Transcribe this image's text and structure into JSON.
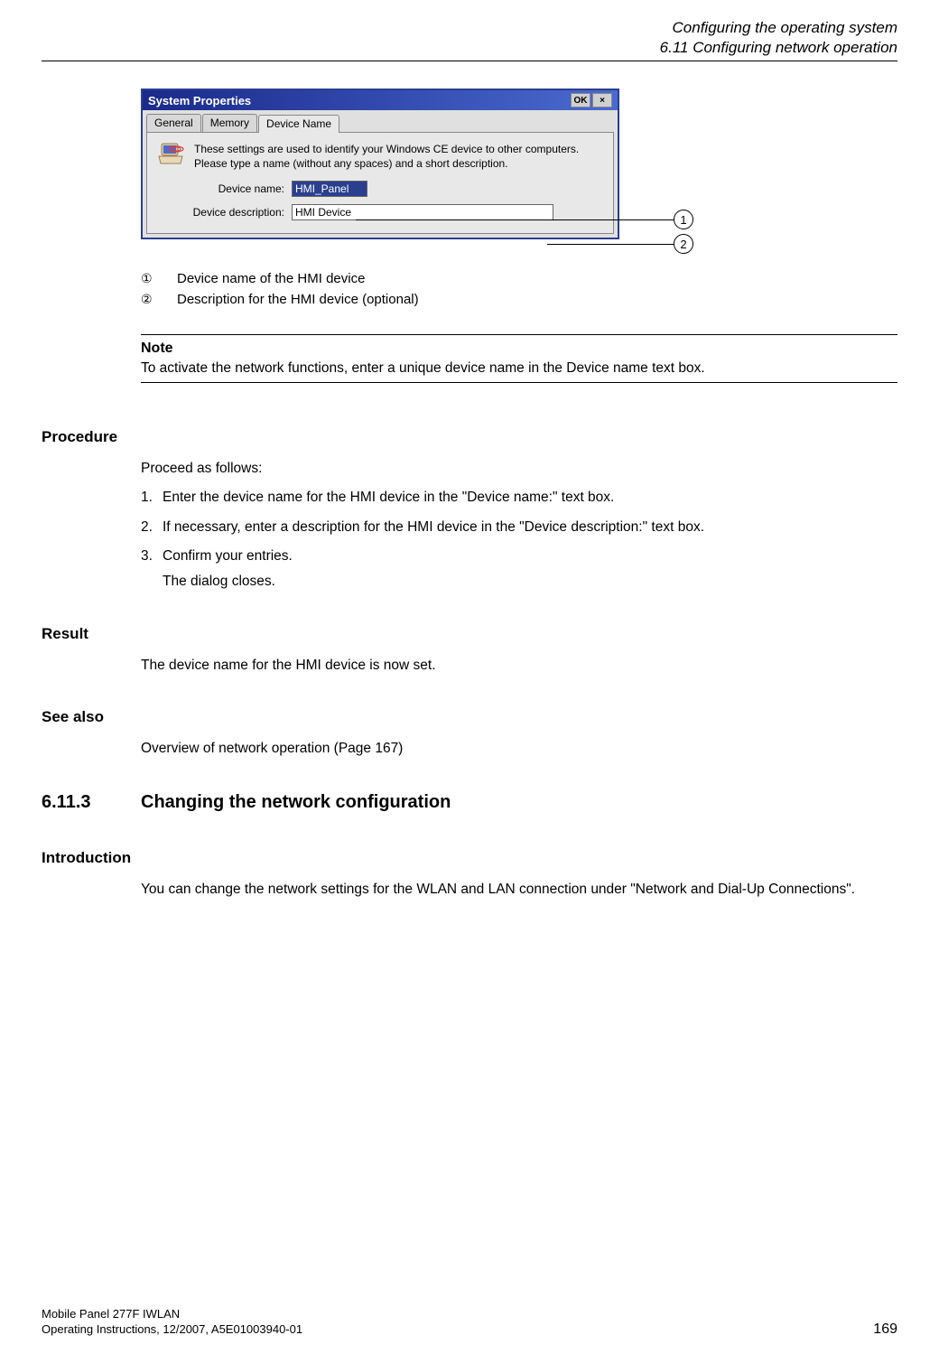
{
  "header": {
    "line1": "Configuring the operating system",
    "line2": "6.11 Configuring network operation"
  },
  "dialog": {
    "title": "System Properties",
    "ok": "OK",
    "close": "×",
    "tabs": {
      "general": "General",
      "memory": "Memory",
      "device_name": "Device Name"
    },
    "intro1": "These settings are used to identify your Windows CE device to other computers.",
    "intro2": "Please type a name (without any spaces) and a short description.",
    "label_name": "Device name:",
    "value_name": "HMI_Panel",
    "label_desc": "Device description:",
    "value_desc": "HMI Device"
  },
  "callouts": {
    "c1": "1",
    "c2": "2"
  },
  "legend": {
    "n1": "①",
    "t1": "Device name of the HMI device",
    "n2": "②",
    "t2": "Description for the HMI device (optional)"
  },
  "note": {
    "label": "Note",
    "text": "To activate the network functions, enter a unique device name in the Device name text box."
  },
  "procedure": {
    "heading": "Procedure",
    "intro": "Proceed as follows:",
    "s1": "Enter the device name for the HMI device in the \"Device name:\" text box.",
    "s2": "If necessary, enter a description for the HMI device in the \"Device description:\" text box.",
    "s3": "Confirm your entries.",
    "s3b": "The dialog closes."
  },
  "result": {
    "heading": "Result",
    "text": "The device name for the HMI device is now set."
  },
  "seealso": {
    "heading": "See also",
    "text": "Overview of network operation (Page 167)"
  },
  "chapter": {
    "num": "6.11.3",
    "title": "Changing the network configuration"
  },
  "introduction": {
    "heading": "Introduction",
    "text": "You can change the network settings for the WLAN and LAN connection under \"Network and Dial-Up Connections\"."
  },
  "footer": {
    "l1": "Mobile Panel 277F IWLAN",
    "l2": "Operating Instructions, 12/2007, A5E01003940-01",
    "page": "169"
  }
}
